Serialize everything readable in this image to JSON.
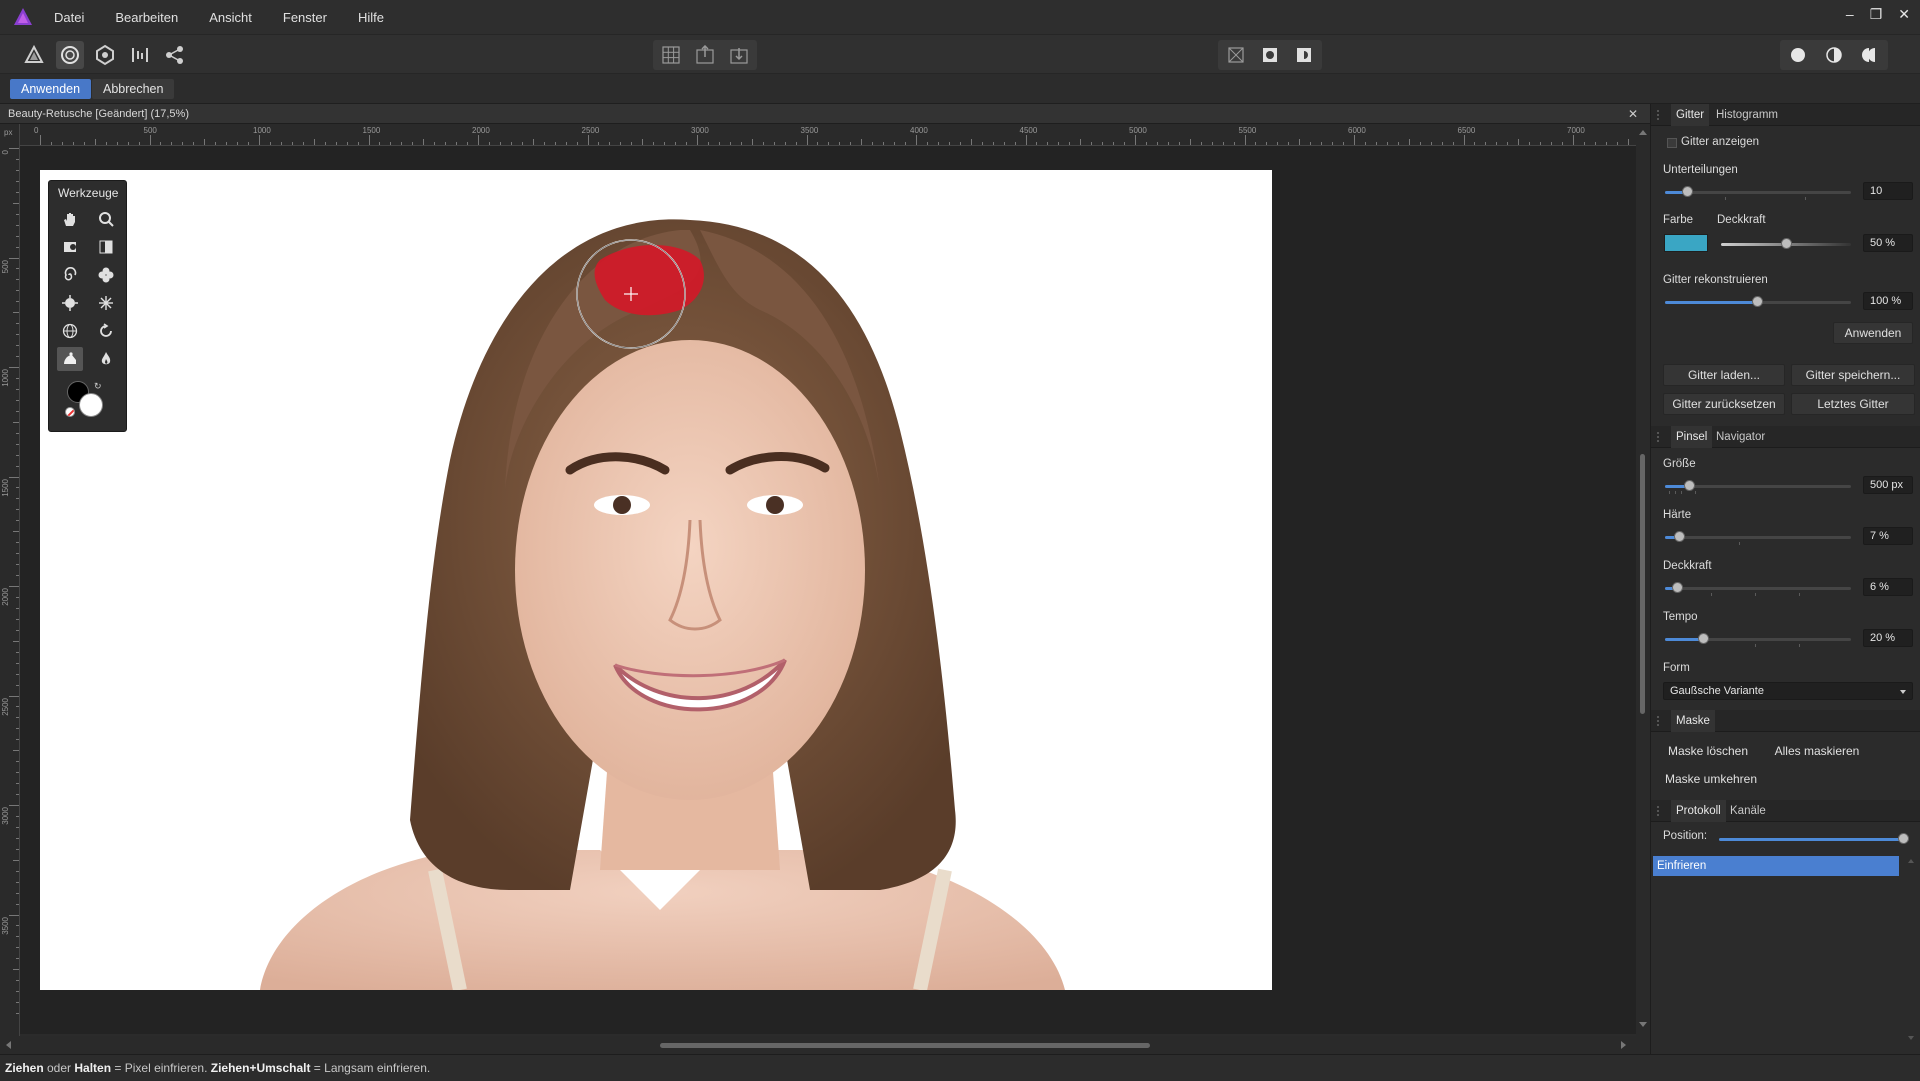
{
  "app": {
    "menus": [
      "Datei",
      "Bearbeiten",
      "Ansicht",
      "Fenster",
      "Hilfe"
    ],
    "window_controls": [
      "–",
      "❐",
      "✕"
    ],
    "accent_color": "#4878c8"
  },
  "context_bar": {
    "apply_label": "Anwenden",
    "cancel_label": "Abbrechen"
  },
  "document": {
    "tab_title": "Beauty-Retusche [Geändert] (17,5%)",
    "close_glyph": "✕"
  },
  "ruler": {
    "h_ticks": [
      "0",
      "500",
      "1000",
      "1500",
      "2000",
      "2500",
      "3000",
      "3500",
      "4000",
      "4500",
      "5000",
      "5500",
      "6000",
      "6500",
      "7000"
    ],
    "v_ticks": [
      "0",
      "500",
      "1000",
      "1500",
      "2000",
      "2500",
      "3000",
      "3500"
    ],
    "unit": "px"
  },
  "tools_panel": {
    "title": "Werkzeuge",
    "tools": [
      "hand-icon",
      "zoom-icon",
      "forward-warp-icon",
      "push-left-icon",
      "twirl-icon",
      "pinch-icon",
      "punch-icon",
      "turbulence-icon",
      "mesh-icon",
      "reconstruct-icon",
      "freeze-icon",
      "thaw-icon"
    ]
  },
  "gitter_panel": {
    "tabs": [
      "Gitter",
      "Histogramm"
    ],
    "show_grid_label": "Gitter anzeigen",
    "show_grid_checked": false,
    "subdivisions_label": "Unterteilungen",
    "subdivisions_value": "10",
    "color_label": "Farbe",
    "color_swatch": "#3aa6c4",
    "opacity_label": "Deckkraft",
    "opacity_value": "50 %",
    "reconstruct_label": "Gitter rekonstruieren",
    "reconstruct_value": "100 %",
    "apply_label": "Anwenden",
    "load_label": "Gitter laden...",
    "save_label": "Gitter speichern...",
    "reset_label": "Gitter zurücksetzen",
    "last_label": "Letztes Gitter"
  },
  "brush_panel": {
    "tabs": [
      "Pinsel",
      "Navigator"
    ],
    "size_label": "Größe",
    "size_value": "500 px",
    "hardness_label": "Härte",
    "hardness_value": "7 %",
    "opacity_label": "Deckkraft",
    "opacity_value": "6 %",
    "speed_label": "Tempo",
    "speed_value": "20 %",
    "shape_label": "Form",
    "shape_value": "Gaußsche Variante"
  },
  "mask_panel": {
    "tabs": [
      "Maske"
    ],
    "clear_label": "Maske löschen",
    "mask_all_label": "Alles maskieren",
    "invert_label": "Maske umkehren"
  },
  "history_panel": {
    "tabs": [
      "Protokoll",
      "Kanäle"
    ],
    "position_label": "Position:",
    "entries": [
      "Einfrieren"
    ]
  },
  "statusbar": {
    "drag": "Ziehen",
    "or": " oder ",
    "hold": "Halten",
    "text1": " = Pixel einfrieren. ",
    "drag_shift": "Ziehen+Umschalt",
    "text2": " = Langsam einfrieren."
  }
}
